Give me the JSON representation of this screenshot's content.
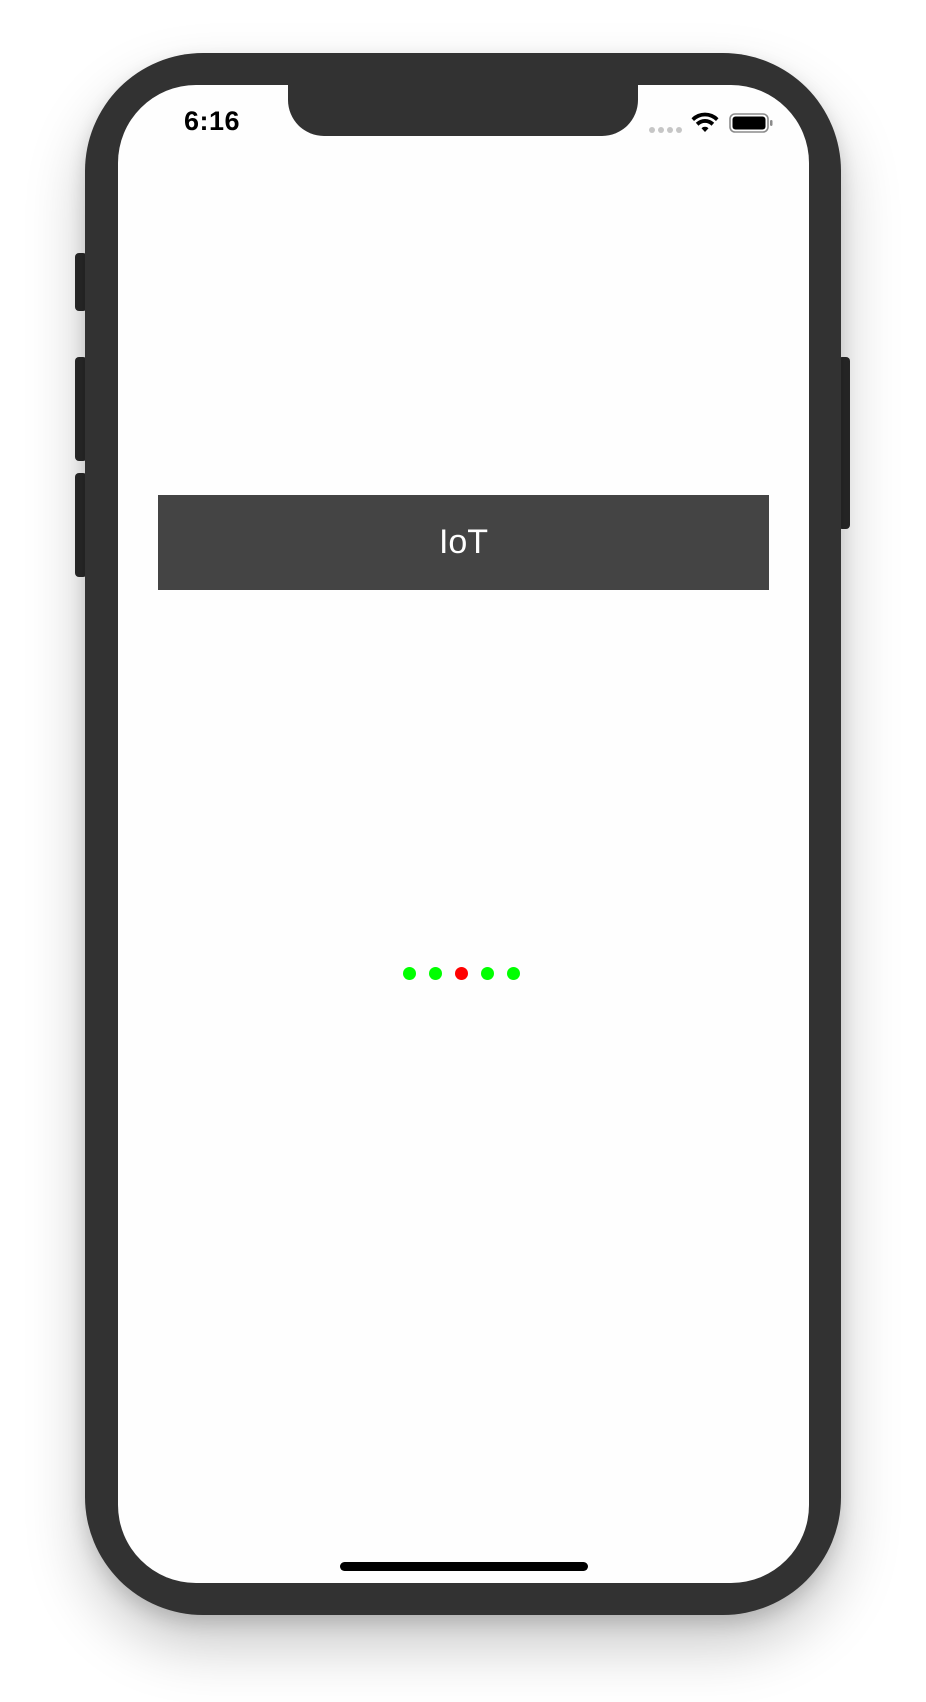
{
  "status_bar": {
    "time": "6:16",
    "signal_icon": "cellular-signal-icon",
    "wifi_icon": "wifi-icon",
    "battery_icon": "battery-icon"
  },
  "main": {
    "title": "IoT",
    "title_bar_color": "#444444",
    "page_indicator": {
      "count": 5,
      "active_index": 2,
      "active_color": "#ff0000",
      "inactive_color": "#00ff00"
    }
  }
}
